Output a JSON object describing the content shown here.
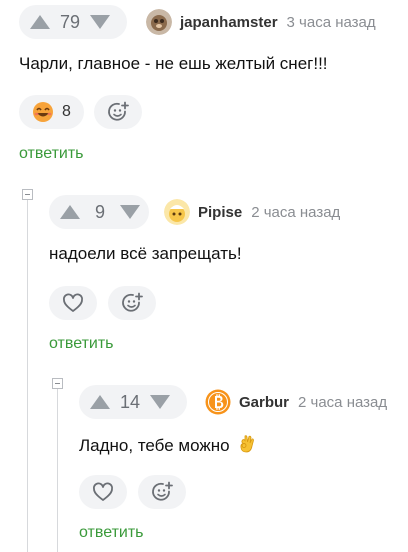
{
  "comments": [
    {
      "score": "79",
      "username": "japanhamster",
      "time": "3 часа назад",
      "text": "Чарли, главное - не ешь желтый снег!!!",
      "reaction_count": "8",
      "reply_label": "ответить"
    },
    {
      "score": "9",
      "username": "Pipise",
      "time": "2 часа назад",
      "text": "надоели всё запрещать!",
      "reply_label": "ответить"
    },
    {
      "score": "14",
      "username": "Garbur",
      "time": "2 часа назад",
      "text": "Ладно, тебе можно",
      "reply_label": "ответить"
    }
  ],
  "icons": {
    "upvote": "triangle-up-icon",
    "downvote": "triangle-down-icon",
    "reaction": "smiling-face-emoji",
    "like": "heart-icon",
    "add_reaction": "add-emoji-icon",
    "ok_hand": "ok-hand-emoji",
    "bitcoin": "bitcoin-icon",
    "collapse": "minus-icon"
  },
  "colors": {
    "reply_green": "#3a9a3a",
    "vote_bg": "#f2f3f5",
    "arrow_gray": "#9aa0a6"
  }
}
